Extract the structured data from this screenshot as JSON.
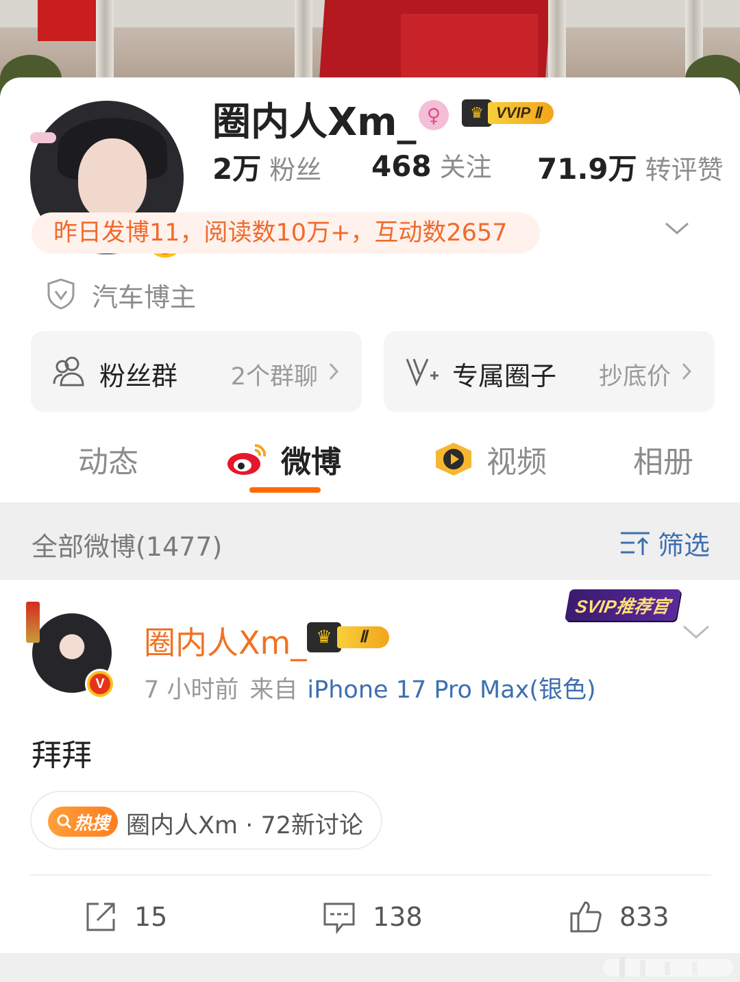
{
  "profile": {
    "username": "圈内人Xm_",
    "gender_icon": "female-icon",
    "vip_label": "VVIP Ⅱ",
    "verified_mark": "V",
    "stats": [
      {
        "value": "2万",
        "label": "粉丝"
      },
      {
        "value": "468",
        "label": "关注"
      },
      {
        "value": "71.9万",
        "label": "转评赞"
      }
    ],
    "summary": "昨日发博11，阅读数10万+，互动数2657",
    "blogger_tag": "汽车博主"
  },
  "cards": {
    "fan_group": {
      "title": "粉丝群",
      "subtitle": "2个群聊"
    },
    "circle": {
      "title": "专属圈子",
      "subtitle": "抄底价"
    }
  },
  "tabs": [
    {
      "label": "动态",
      "active": false
    },
    {
      "label": "微博",
      "active": true
    },
    {
      "label": "视频",
      "active": false
    },
    {
      "label": "相册",
      "active": false
    }
  ],
  "filter_bar": {
    "all_label": "全部微博(1477)",
    "filter_label": "筛选"
  },
  "post": {
    "author": "圈内人Xm_",
    "level_badge": "Ⅱ",
    "svip_badge": "SVIP推荐官",
    "time": "7 小时前",
    "from_label": "来自",
    "device": "iPhone 17 Pro Max(银色)",
    "text": "拜拜",
    "hot_tag": "热搜",
    "hot_text": "圈内人Xm · 72新讨论",
    "repost_count": "15",
    "comment_count": "138",
    "like_count": "833"
  },
  "colors": {
    "accent": "#ff6a00",
    "name_orange": "#f07222",
    "link_blue": "#3d6fb0",
    "summary_bg": "#fff1ec"
  }
}
